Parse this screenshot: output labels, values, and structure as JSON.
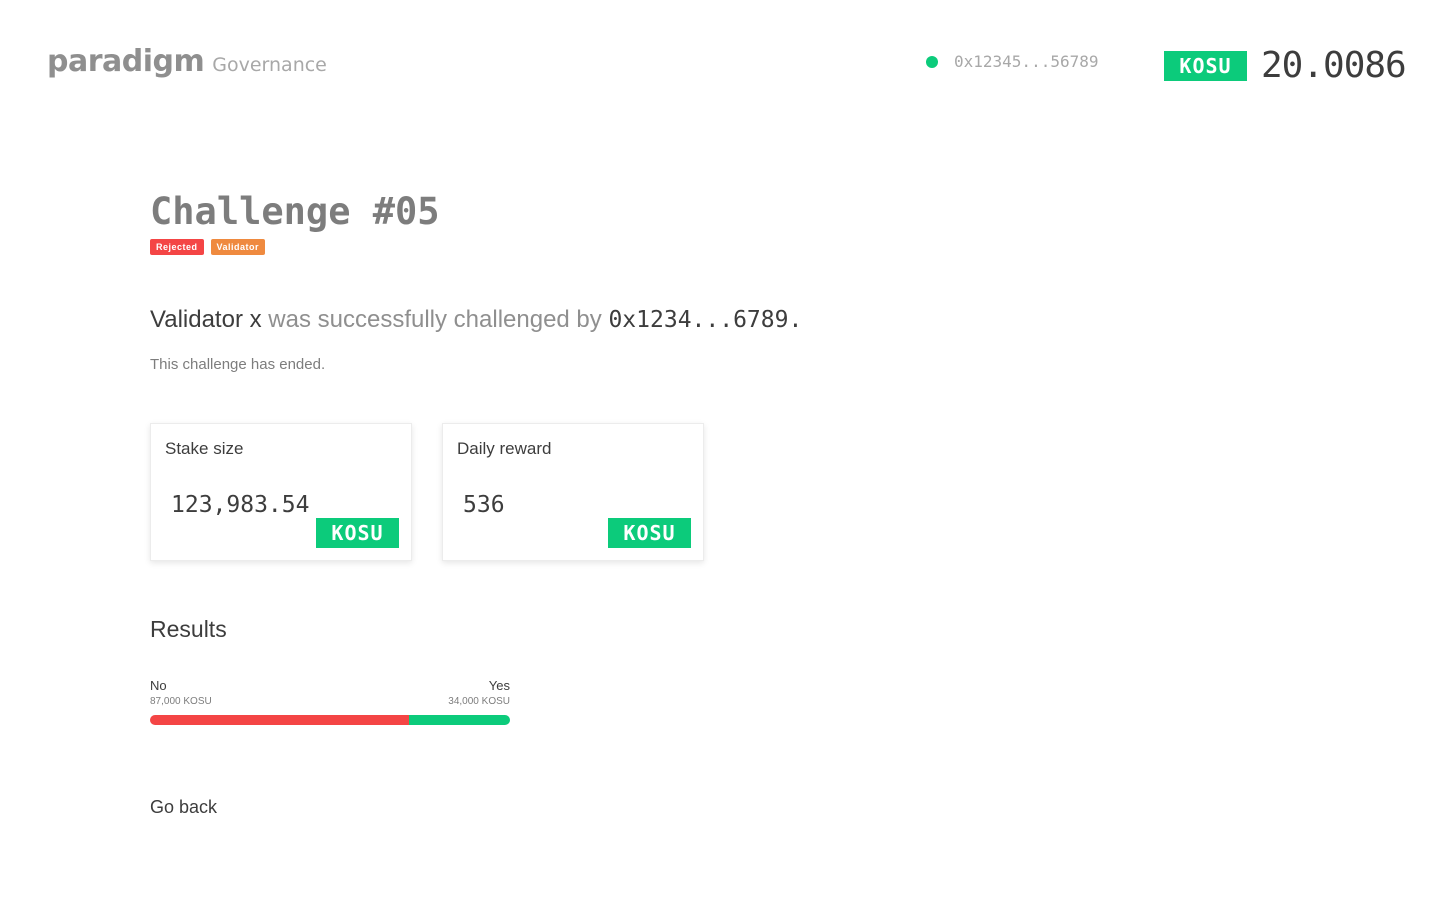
{
  "header": {
    "logo": "paradigm",
    "logo_sub": "Governance",
    "wallet_address": "0x12345...56789",
    "wallet_status_color": "#0ccb7b",
    "balance_token": "KOSU",
    "balance_value": "20.0086"
  },
  "challenge": {
    "title": "Challenge #05",
    "tags": [
      "Rejected",
      "Validator"
    ],
    "tag_colors": {
      "rejected": "#f44545",
      "validator": "#ef8a3f"
    },
    "headline_subject": "Validator x",
    "headline_middle": " was successfully challenged by ",
    "headline_address": "0x1234...6789.",
    "status_text": "This challenge has ended."
  },
  "cards": {
    "stake": {
      "label": "Stake size",
      "value": "123,983.54",
      "token": "KOSU"
    },
    "reward": {
      "label": "Daily reward",
      "value": "536",
      "token": "KOSU"
    }
  },
  "results": {
    "title": "Results",
    "no_label": "No",
    "no_amount": "87,000 KOSU",
    "no_value": 87000,
    "yes_label": "Yes",
    "yes_amount": "34,000 KOSU",
    "yes_value": 34000,
    "no_color": "#f44545",
    "yes_color": "#0ccb7b"
  },
  "nav": {
    "go_back": "Go back"
  }
}
